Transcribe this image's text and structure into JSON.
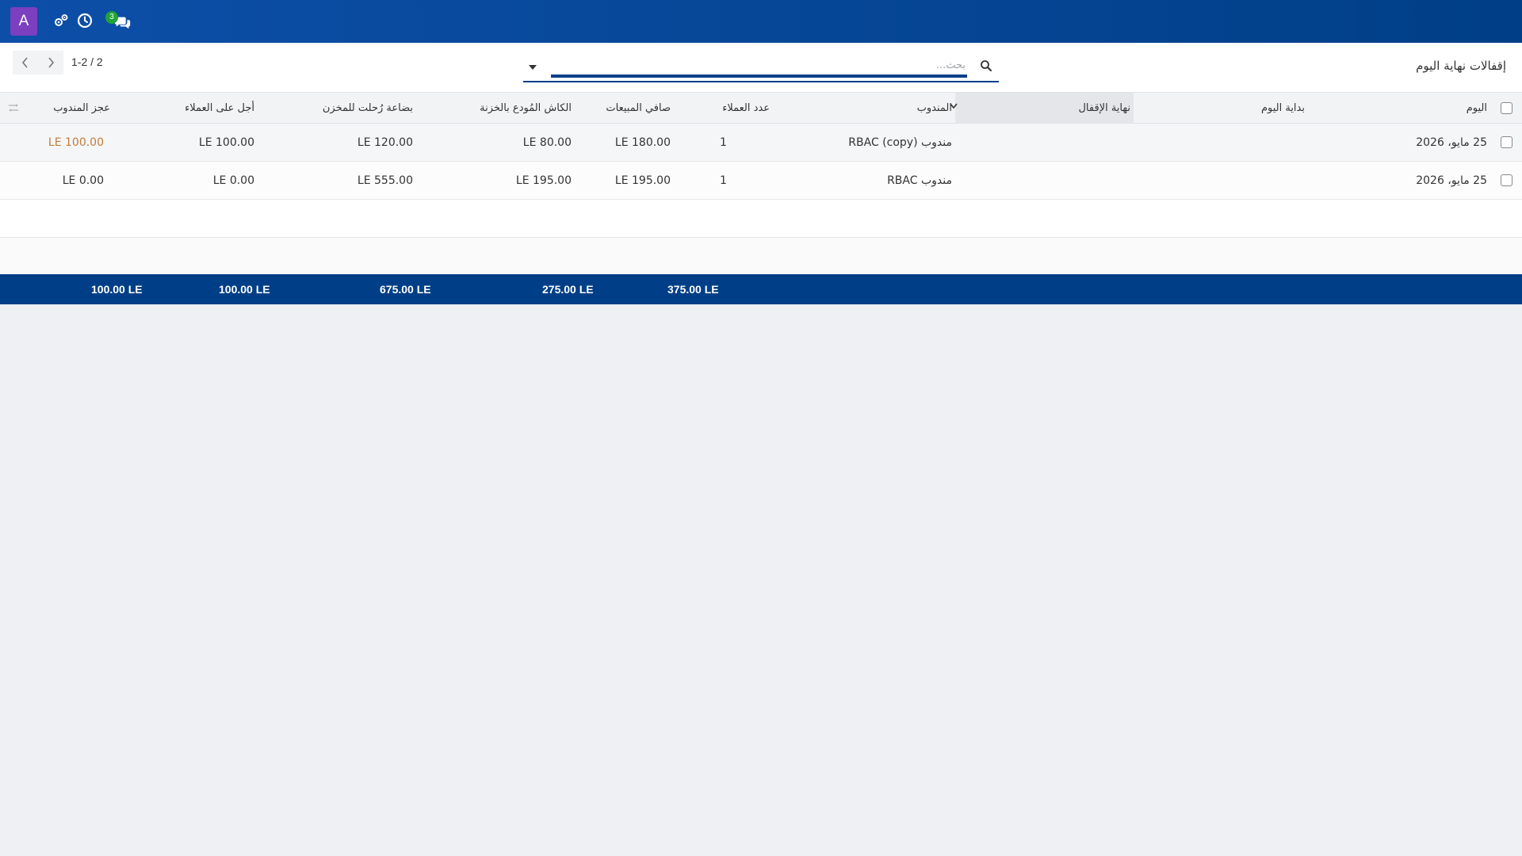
{
  "topbar": {
    "avatar_letter": "A",
    "chat_badge_count": "3",
    "icons": [
      "settings-gears-icon",
      "clock-icon",
      "chat-icon"
    ]
  },
  "control": {
    "title": "إقفالات نهاية اليوم",
    "search_placeholder": "بحث...",
    "pager": "1-2 / 2"
  },
  "table": {
    "headers": {
      "day": "اليوم",
      "day_start": "بداية اليوم",
      "close_end": "نهاية الإقفال",
      "rep": "المندوب",
      "customers": "عدد العملاء",
      "net_sales": "صافي المبيعات",
      "cash": "الكاش المُودع بالخزنة",
      "goods": "بضاعة رُحلت للمخزن",
      "credit": "أجل على العملاء",
      "deficit": "عجز المندوب"
    },
    "rows": [
      {
        "day": "25 مايو، 2026",
        "day_start": "",
        "close_end": "",
        "rep": "مندوب RBAC (copy)",
        "customers": "1",
        "net_sales": "180.00 LE",
        "cash": "80.00 LE",
        "goods": "120.00 LE",
        "credit": "100.00 LE",
        "deficit": "100.00 LE"
      },
      {
        "day": "25 مايو، 2026",
        "day_start": "",
        "close_end": "",
        "rep": "مندوب RBAC",
        "customers": "1",
        "net_sales": "195.00 LE",
        "cash": "195.00 LE",
        "goods": "555.00 LE",
        "credit": "0.00 LE",
        "deficit": "0.00 LE"
      }
    ],
    "totals": {
      "net_sales": "375.00 LE",
      "cash": "275.00 LE",
      "goods": "675.00 LE",
      "credit": "100.00 LE",
      "deficit": "100.00 LE"
    }
  },
  "colors": {
    "brand": "#003f87",
    "avatar": "#7b3fbf",
    "badge": "#21a336",
    "deficit_warn": "#c27c3a"
  }
}
